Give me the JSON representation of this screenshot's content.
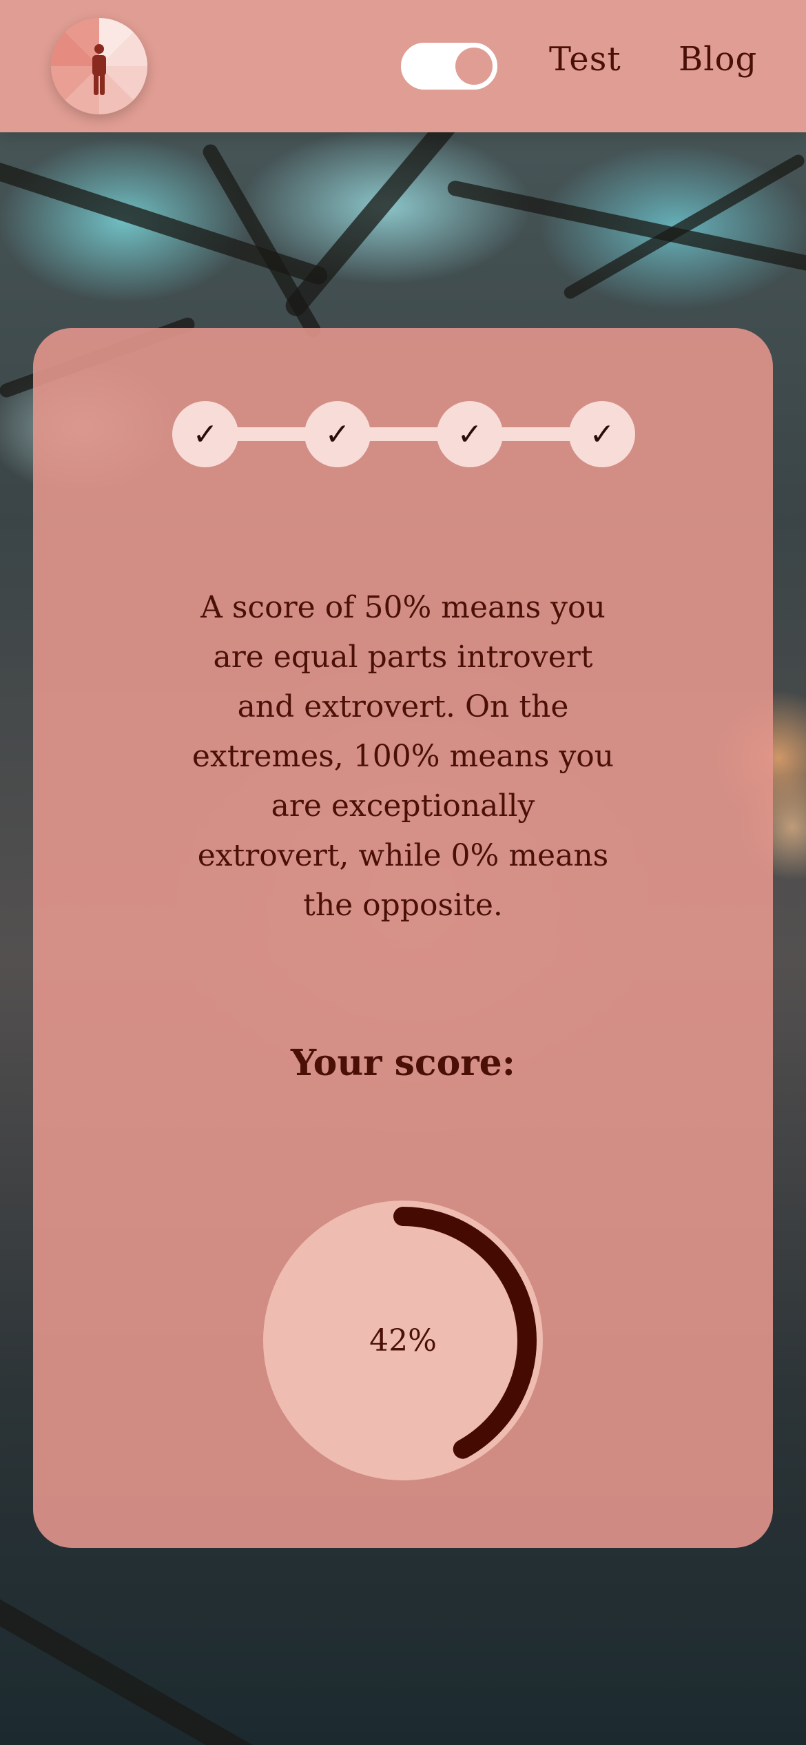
{
  "header": {
    "logo_icon": "person-icon",
    "theme_toggle": {
      "state": "on"
    },
    "nav": [
      {
        "label": "Test"
      },
      {
        "label": "Blog"
      }
    ]
  },
  "card": {
    "steps": [
      {
        "mark": "✓",
        "state": "complete"
      },
      {
        "mark": "✓",
        "state": "complete"
      },
      {
        "mark": "✓",
        "state": "complete"
      },
      {
        "mark": "✓",
        "state": "complete"
      }
    ],
    "explanation": "A score of 50% means you are equal parts introvert and extrovert. On the extremes, 100% means you are exceptionally extrovert, while 0% means the opposite.",
    "score_label": "Your score:",
    "score_text": "42%",
    "score_fraction": 0.42
  },
  "colors": {
    "header_bg": "#e09d93",
    "card_bg": "#e2968c",
    "text": "#4a1008",
    "step_bg": "#f8dcd7",
    "gauge_track": "#efbcb2",
    "gauge_fill": "#450a02"
  }
}
